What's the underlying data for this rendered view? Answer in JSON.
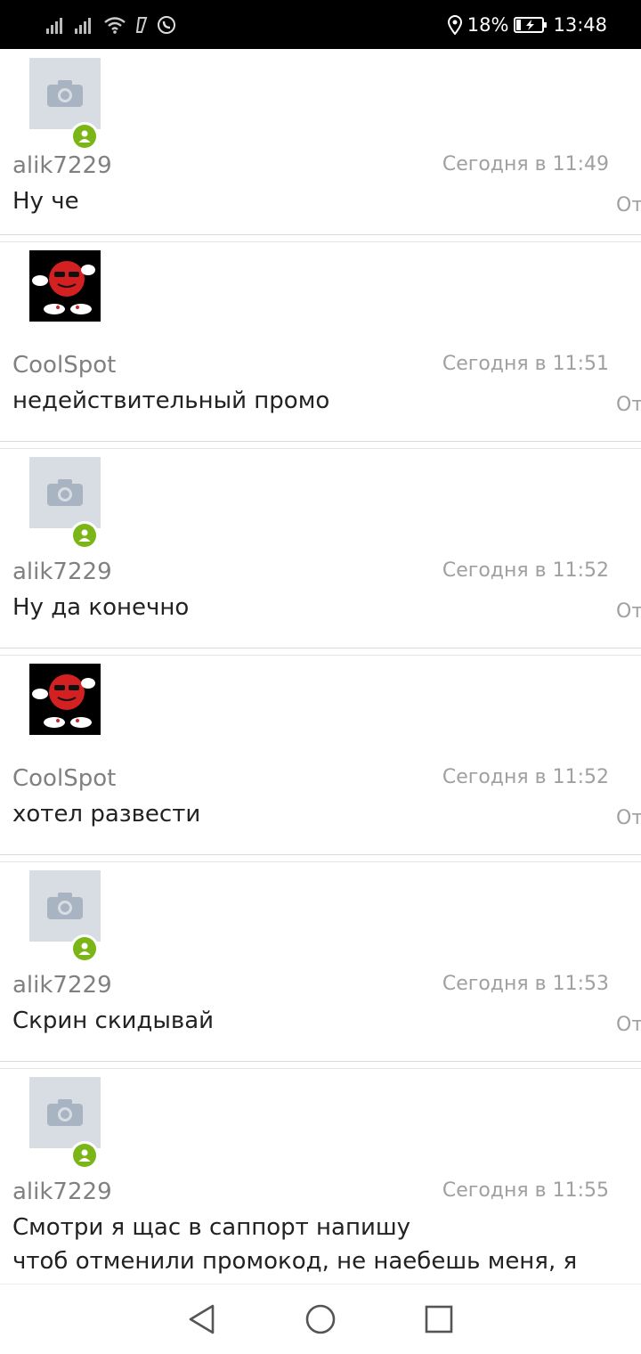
{
  "status_bar": {
    "battery": "18%",
    "time": "13:48",
    "icons": [
      "signal-icon",
      "signal-icon",
      "wifi-icon",
      "nfc-icon",
      "whatsapp-icon",
      "location-icon",
      "battery-icon"
    ]
  },
  "posts": [
    {
      "username": "alik7229",
      "time": "Сегодня в 11:49",
      "message": "Ну че",
      "reply": "От",
      "avatar": "placeholder",
      "online": true
    },
    {
      "username": "CoolSpot",
      "time": "Сегодня в 11:51",
      "message": "недействительный промо",
      "reply": "От",
      "avatar": "coolspot",
      "online": false
    },
    {
      "username": "alik7229",
      "time": "Сегодня в 11:52",
      "message": "Ну да конечно",
      "reply": "От",
      "avatar": "placeholder",
      "online": true
    },
    {
      "username": "CoolSpot",
      "time": "Сегодня в 11:52",
      "message": "хотел развести",
      "reply": "От",
      "avatar": "coolspot",
      "online": false
    },
    {
      "username": "alik7229",
      "time": "Сегодня в 11:53",
      "message": "Скрин скидывай",
      "reply": "От",
      "avatar": "placeholder",
      "online": true
    },
    {
      "username": "alik7229",
      "time": "Сегодня в 11:55",
      "message": "Смотри я щас в саппорт напишу\nчтоб отменили промокод, не наебешь меня, я\nуже так делал которые меня кинуть забрались",
      "reply": "От",
      "avatar": "placeholder",
      "online": true
    }
  ],
  "navbar": {
    "buttons": [
      "back-icon",
      "home-icon",
      "recents-icon"
    ]
  },
  "colors": {
    "online": "#7cb518",
    "avatar_placeholder": "#d8dde4",
    "username": "#808080",
    "time": "#a0a0a0"
  }
}
